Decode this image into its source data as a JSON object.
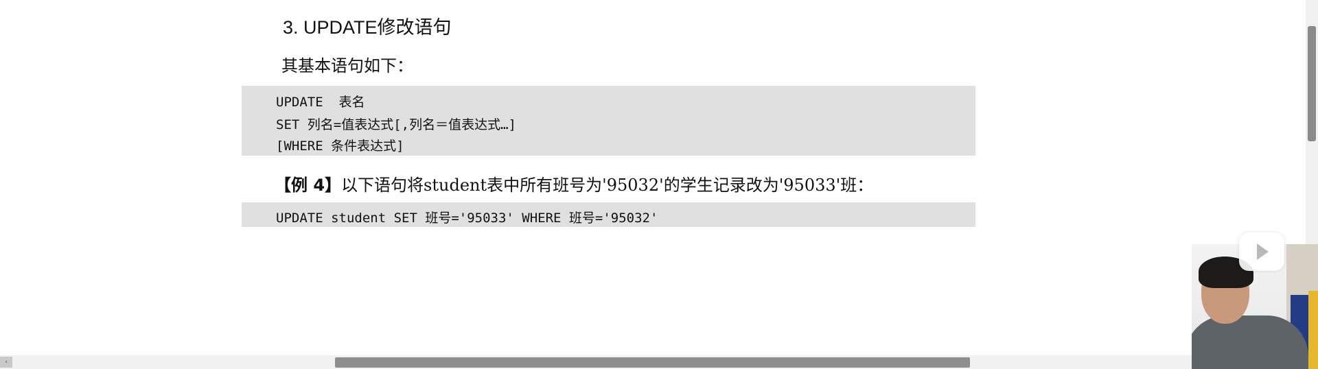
{
  "document": {
    "heading": "3. UPDATE修改语句",
    "intro": "其基本语句如下：",
    "syntax_lines": [
      "UPDATE  表名",
      "SET 列名=值表达式[,列名＝值表达式…]",
      "[WHERE 条件表达式]"
    ],
    "example": {
      "label": "【例 4】",
      "text": "以下语句将student表中所有班号为'95032'的学生记录改为'95033'班：",
      "code": "UPDATE student SET 班号='95033' WHERE 班号='95032'"
    }
  },
  "scrollbars": {
    "left_arrow": "‹"
  },
  "overlay": {
    "play_icon": "play-icon",
    "webcam": "presenter webcam"
  },
  "colors": {
    "code_background": "#e0e0e0",
    "scroll_thumb": "#8e8e8e"
  }
}
